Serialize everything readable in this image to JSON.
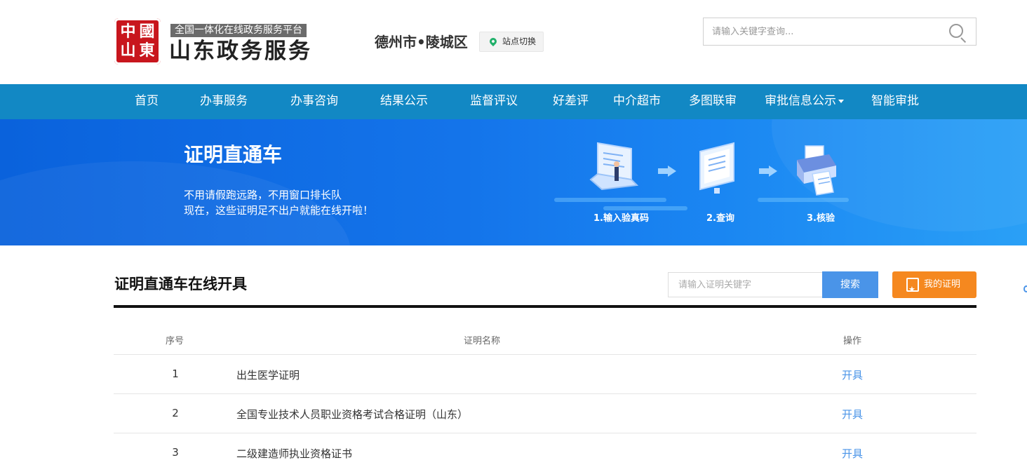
{
  "header": {
    "seal_chars": [
      "中",
      "國",
      "山",
      "東"
    ],
    "platform_tag": "全国一体化在线政务服务平台",
    "site_title": "山东政务服务",
    "region": "德州市•陵城区",
    "site_switch_label": "站点切换",
    "search_placeholder": "请输入关键字查询..."
  },
  "nav": {
    "items": [
      {
        "label": "首页"
      },
      {
        "label": "办事服务"
      },
      {
        "label": "办事咨询"
      },
      {
        "label": "结果公示"
      },
      {
        "label": "监督评议"
      },
      {
        "label": "好差评"
      },
      {
        "label": "中介超市"
      },
      {
        "label": "多图联审"
      },
      {
        "label": "审批信息公示"
      },
      {
        "label": "智能审批"
      }
    ]
  },
  "banner": {
    "title": "证明直通车",
    "subtitle_line1": "不用请假跑远路，不用窗口排长队",
    "subtitle_line2": "现在，这些证明足不出户就能在线开啦！",
    "steps": [
      {
        "label": "1.输入验真码",
        "icon": "laptop-icon"
      },
      {
        "label": "2.查询",
        "icon": "monitor-icon"
      },
      {
        "label": "3.核验",
        "icon": "printer-icon"
      }
    ],
    "colors": {
      "from": "#0a62dc",
      "to": "#2aa0f6"
    }
  },
  "section": {
    "title": "证明直通车在线开具",
    "search_placeholder": "请输入证明关键字",
    "search_button": "搜索",
    "my_cert_button": "我的证明"
  },
  "table": {
    "headers": [
      "序号",
      "证明名称",
      "操作"
    ],
    "rows": [
      {
        "num": "1",
        "name": "出生医学证明",
        "action": "开具"
      },
      {
        "num": "2",
        "name": "全国专业技术人员职业资格考试合格证明（山东）",
        "action": "开具"
      },
      {
        "num": "3",
        "name": "二级建造师执业资格证书",
        "action": "开具"
      }
    ]
  },
  "colors": {
    "nav_bg": "#1288c4",
    "accent_blue": "#4a94e8",
    "accent_orange": "#f5881f",
    "seal_red": "#c8161d"
  }
}
